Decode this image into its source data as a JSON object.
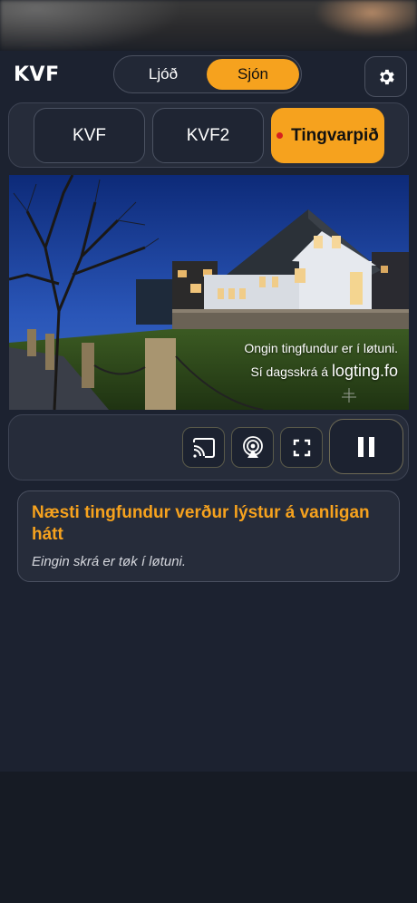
{
  "header": {
    "logo": "KVF",
    "modes": [
      "Ljóð",
      "Sjón"
    ],
    "active_mode": "Sjón",
    "settings_icon": "gear-icon"
  },
  "channels": {
    "items": [
      "KVF",
      "KVF2",
      "Tingvarpið"
    ],
    "active": "Tingvarpið"
  },
  "video": {
    "overlay_line1": "Ongin tingfundur er í løtuni.",
    "overlay_line2_prefix": "Sí dagsskrá á",
    "overlay_line2_link": "logting.fo"
  },
  "controls": {
    "icons": [
      "cast-icon",
      "airplay-icon",
      "fullscreen-icon",
      "pause-icon"
    ]
  },
  "info": {
    "title": "Næsti tingfundur verður lýstur á vanligan hátt",
    "subtitle": "Eingin skrá er tøk í løtuni."
  },
  "colors": {
    "accent": "#f6a21e",
    "background": "#1c2230",
    "panel": "#262c3a",
    "live": "#d6201e"
  }
}
